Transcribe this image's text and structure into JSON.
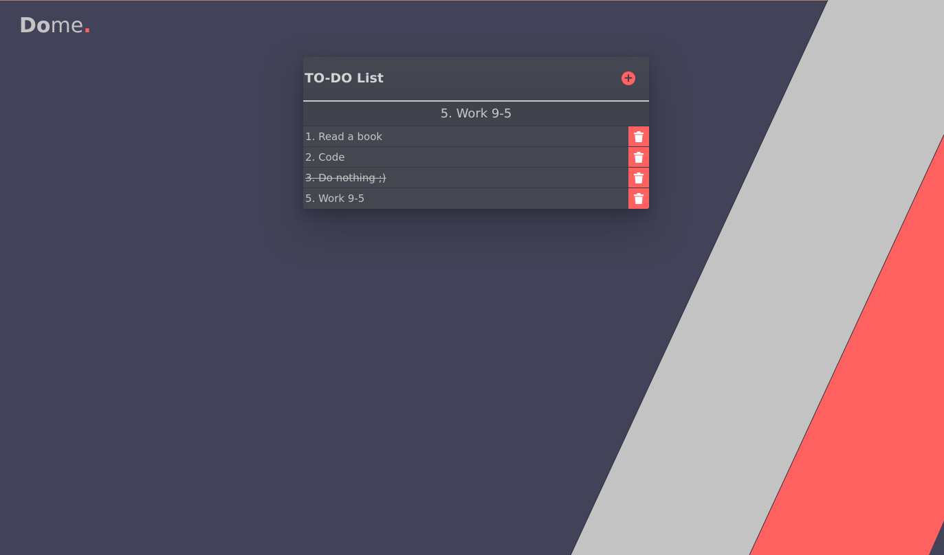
{
  "brand": {
    "logo_bold": "Do",
    "logo_light": "me",
    "logo_dot": ".",
    "accent_color": "#ff6060"
  },
  "todo": {
    "title": "TO-DO List",
    "add_icon": "plus-circle-icon",
    "selected_task": "5. Work 9-5",
    "tasks": [
      {
        "label": "1. Read a book",
        "done": false,
        "delete_icon": "trash-icon"
      },
      {
        "label": "2. Code",
        "done": false,
        "delete_icon": "trash-icon"
      },
      {
        "label": "3. Do nothing ;)",
        "done": true,
        "delete_icon": "trash-icon"
      },
      {
        "label": "5. Work 9-5",
        "done": false,
        "delete_icon": "trash-icon"
      }
    ]
  },
  "colors": {
    "background": "#424358",
    "stripe_gray": "#c3c3c3",
    "stripe_red": "#ff6161"
  }
}
